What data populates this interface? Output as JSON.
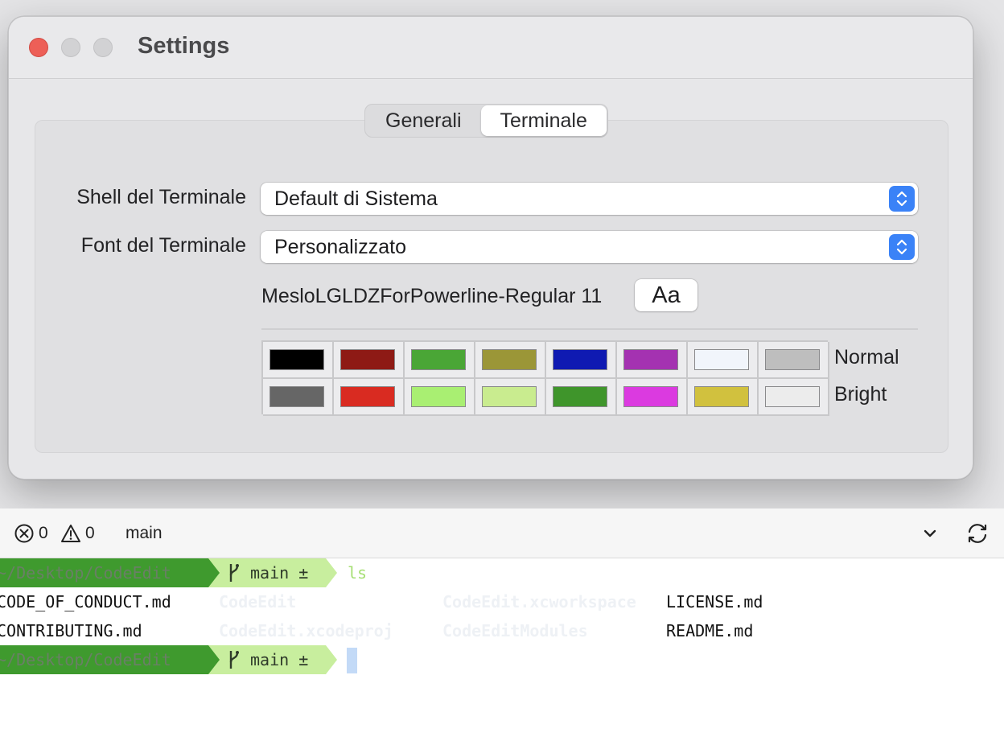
{
  "window": {
    "title": "Settings",
    "tabs": [
      {
        "label": "Generali",
        "active": false
      },
      {
        "label": "Terminale",
        "active": true
      }
    ]
  },
  "settings": {
    "shell": {
      "label": "Shell del Terminale",
      "value": "Default di Sistema"
    },
    "font": {
      "label": "Font del Terminale",
      "value": "Personalizzato"
    },
    "font_name": "MesloLGLDZForPowerline-Regular 11",
    "font_button_label": "Aa"
  },
  "palette": {
    "rows": [
      {
        "label": "Normal",
        "colors": [
          "#000000",
          "#8e1a15",
          "#4aa636",
          "#9b9637",
          "#0f1ab2",
          "#a432b1",
          "#f1f5fb",
          "#bebebe"
        ]
      },
      {
        "label": "Bright",
        "colors": [
          "#666666",
          "#d92b21",
          "#a9ef72",
          "#c9ec8f",
          "#3f952b",
          "#db3ae0",
          "#d1c13e",
          "#ececec"
        ]
      }
    ]
  },
  "statusbar": {
    "errors": "0",
    "warnings": "0",
    "branch": "main"
  },
  "terminal": {
    "prompts": [
      {
        "path": "~/Desktop/CodeEdit",
        "branch": "main ±",
        "command": "ls"
      },
      {
        "path": "~/Desktop/CodeEdit",
        "branch": "main ±",
        "command": ""
      }
    ],
    "ls_output": {
      "row1": [
        "CODE_OF_CONDUCT.md",
        "CodeEdit",
        "CodeEdit.xcworkspace",
        "LICENSE.md"
      ],
      "row2": [
        "CONTRIBUTING.md",
        "CodeEdit.xcodeproj",
        "CodeEditModules",
        "README.md"
      ]
    },
    "colors": {
      "path_bg": "#3f9a2e",
      "branch_bg": "#c8ee9e",
      "command": "#a6df74"
    }
  }
}
